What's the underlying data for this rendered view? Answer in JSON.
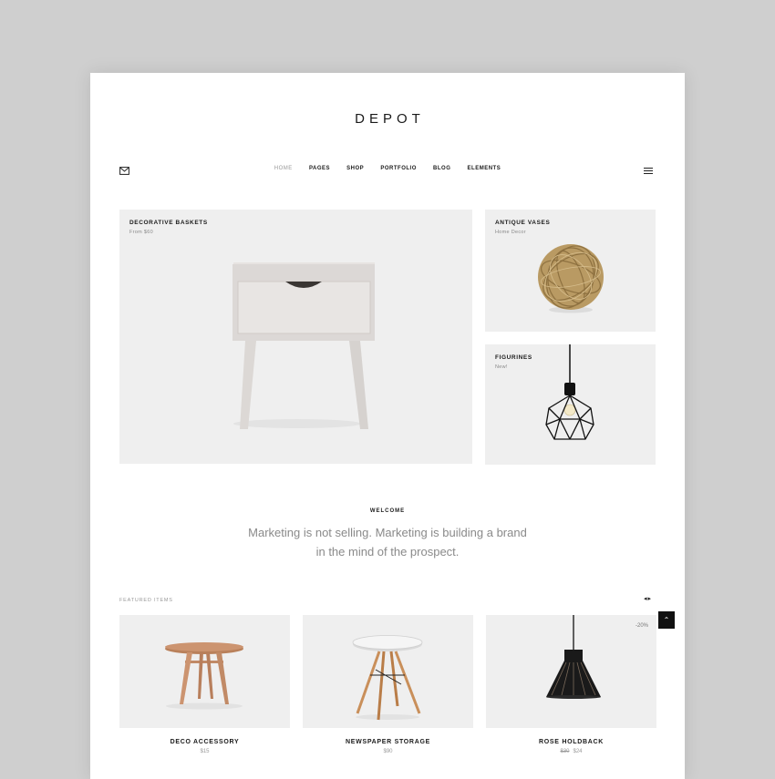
{
  "header": {
    "logo": "DEPOT"
  },
  "nav": [
    {
      "label": "HOME",
      "active": true
    },
    {
      "label": "PAGES",
      "active": false
    },
    {
      "label": "SHOP",
      "active": false
    },
    {
      "label": "PORTFOLIO",
      "active": false
    },
    {
      "label": "BLOG",
      "active": false
    },
    {
      "label": "ELEMENTS",
      "active": false
    }
  ],
  "icons": {
    "left": "envelope-icon",
    "right": "hamburger-menu-icon"
  },
  "hero": {
    "main": {
      "title": "Decorative Baskets",
      "subtitle": "From $60"
    },
    "side_top": {
      "title": "Antique Vases",
      "subtitle": "Home Decor"
    },
    "side_bottom": {
      "title": "Figurines",
      "subtitle": "New!"
    }
  },
  "welcome": {
    "label": "WELCOME",
    "quote_line1": "Marketing is not selling. Marketing is building a brand",
    "quote_line2": "in the mind of the prospect."
  },
  "featured": {
    "label": "FEATURED ITEMS",
    "prev": "◂",
    "next": "▸",
    "items": [
      {
        "name": "DECO ACCESSORY",
        "price": "$15",
        "old_price": ""
      },
      {
        "name": "NEWSPAPER STORAGE",
        "price": "$90",
        "old_price": ""
      },
      {
        "name": "ROSE HOLDBACK",
        "price": "$24",
        "old_price": "$30",
        "badge": "-20%"
      }
    ]
  },
  "scroll_top": "⌃",
  "colors": {
    "background": "#cfcfcf",
    "tile": "#efefef",
    "text": "#1a1a1a",
    "muted": "#8a8a8a"
  }
}
